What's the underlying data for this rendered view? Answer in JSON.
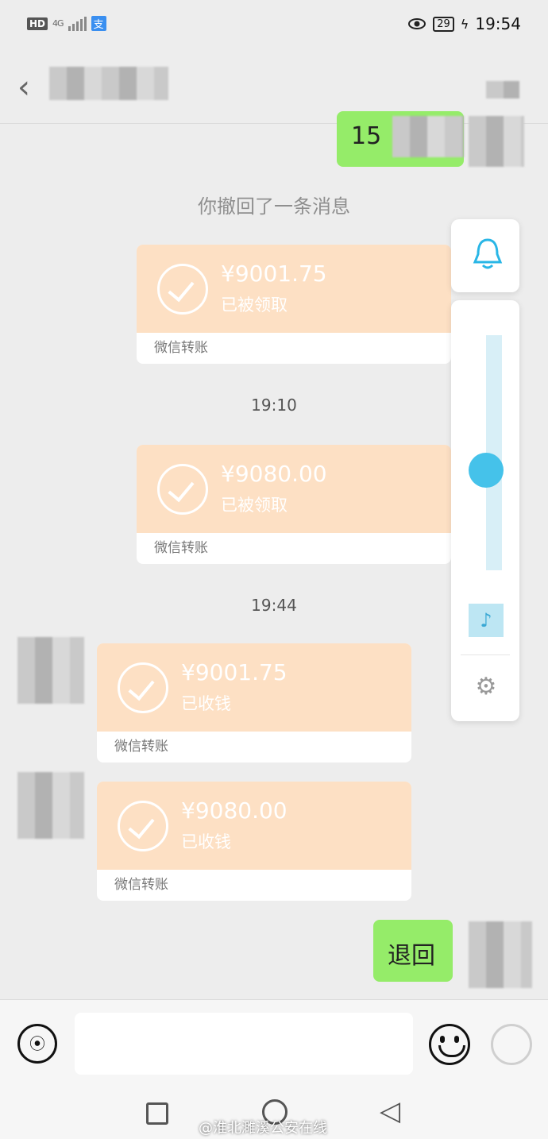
{
  "status_bar": {
    "hd": "HD",
    "signal": "4G",
    "time": "19:54",
    "battery": "29",
    "pay_icon": "支"
  },
  "chat": {
    "sent_partial": "15",
    "recall_notice": "你撤回了一条消息",
    "times": [
      "19:10",
      "19:44"
    ],
    "transfers": [
      {
        "amount": "¥9001.75",
        "status": "已被领取",
        "footer": "微信转账"
      },
      {
        "amount": "¥9080.00",
        "status": "已被领取",
        "footer": "微信转账"
      },
      {
        "amount": "¥9001.75",
        "status": "已收钱",
        "footer": "微信转账"
      },
      {
        "amount": "¥9080.00",
        "status": "已收钱",
        "footer": "微信转账"
      }
    ],
    "last_message": "退回"
  },
  "watermark": "@淮北濉溪公安在线",
  "colors": {
    "green_bubble": "#95ec69",
    "transfer_card": "#fde0c4",
    "bg": "#ededed"
  }
}
